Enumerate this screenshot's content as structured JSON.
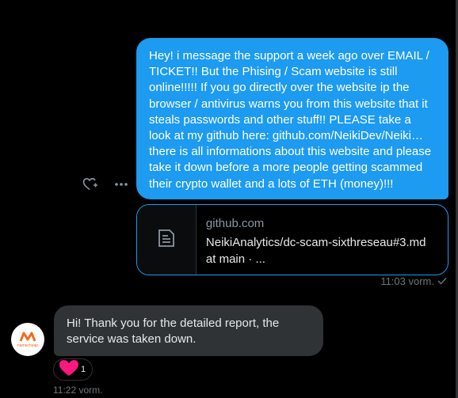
{
  "outgoing": {
    "message": "Hey! i message the support a week ago over EMAIL / TICKET!! But the Phising / Scam website is still online!!!!! If you go directly over the website ip the browser / antivirus warns you from this website that it steals passwords and other stuff!! PLEASE take a look at my github here: github.com/NeikiDev/Neiki… there is all informations about this website and please take it down before a more people getting scammed their crypto wallet and a lots of ETH (money)!!!",
    "link_card": {
      "domain": "github.com",
      "title": "NeikiAnalytics/dc-scam-sixthreseau#3.md at main · ...",
      "icon": "document-icon"
    },
    "time": "11:03 vorm.",
    "status_icon": "check-icon"
  },
  "actions": {
    "react_icon": "heart-plus-icon",
    "more_icon": "more-icon"
  },
  "incoming": {
    "avatar_label": "namecheap",
    "message": "Hi! Thank you for the detailed report, the service was taken down.",
    "reaction": {
      "emoji": "heart",
      "count": "1"
    },
    "time": "11:22 vorm."
  },
  "colors": {
    "bubble_out": "#1d9bf0",
    "bubble_in": "#2f3336",
    "background": "#000000",
    "heart": "#f91880",
    "brand": "#f26b1d"
  }
}
